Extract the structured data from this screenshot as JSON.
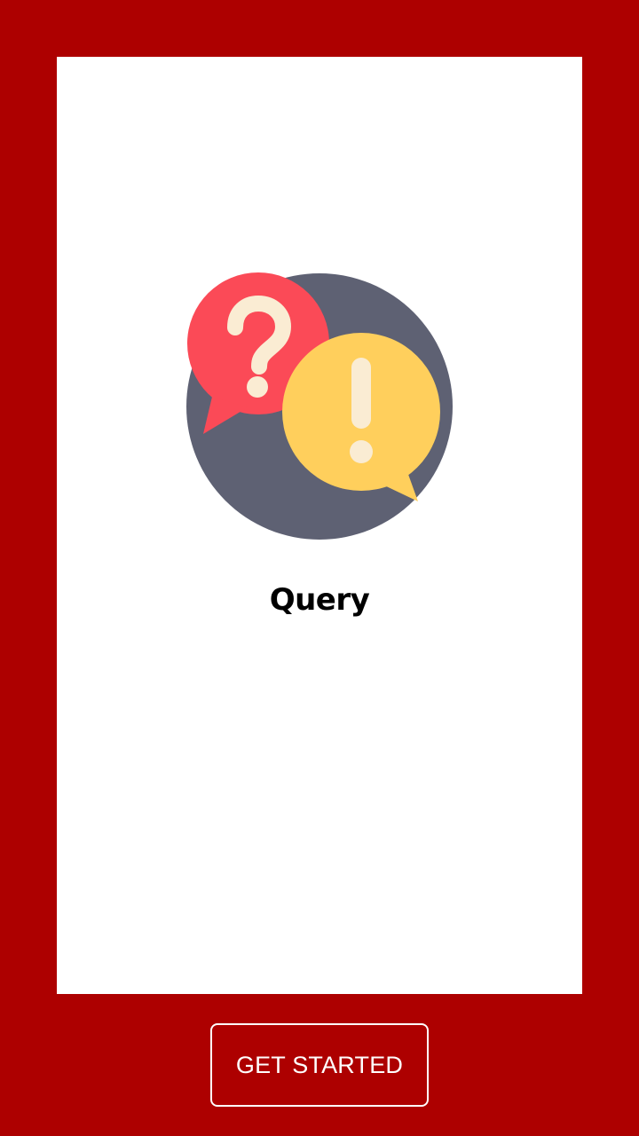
{
  "page": {
    "background_color": "#ad0000",
    "card_color": "#ffffff"
  },
  "onboarding": {
    "illustration": {
      "icon_name": "question-exclamation-bubbles-icon",
      "colors": {
        "circle": "#5e6173",
        "question_bubble": "#fb4a57",
        "exclamation_bubble": "#ffcf5c",
        "glyph": "#faecd3"
      }
    },
    "title": "Query"
  },
  "footer": {
    "get_started_label": "GET STARTED"
  }
}
